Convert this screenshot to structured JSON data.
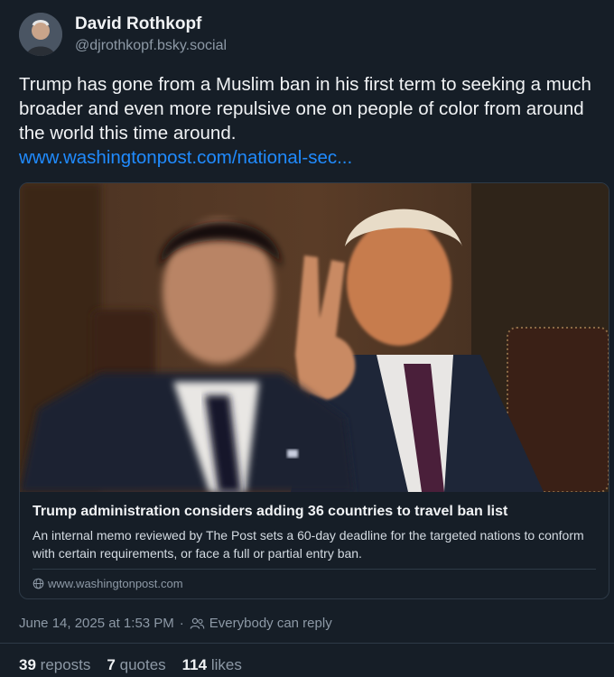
{
  "author": {
    "name": "David Rothkopf",
    "handle": "@djrothkopf.bsky.social"
  },
  "post": {
    "text": "Trump has gone from a Muslim ban in his first term to seeking a much broader and even more repulsive one on people of color from around the world this time around.",
    "link_text": "www.washingtonpost.com/national-sec..."
  },
  "card": {
    "title": "Trump administration considers adding 36 countries to travel ban list",
    "description": "An internal memo reviewed by The Post sets a 60-day deadline for the targeted nations to conform with certain requirements, or face a full or partial entry ban.",
    "domain": "www.washingtonpost.com"
  },
  "meta": {
    "timestamp": "June 14, 2025 at 1:53 PM",
    "separator": "·",
    "reply_setting": "Everybody can reply"
  },
  "stats": {
    "reposts_count": "39",
    "reposts_label": "reposts",
    "quotes_count": "7",
    "quotes_label": "quotes",
    "likes_count": "114",
    "likes_label": "likes"
  },
  "colors": {
    "background": "#161e27",
    "link": "#208bfe",
    "muted": "#8d99a6"
  }
}
